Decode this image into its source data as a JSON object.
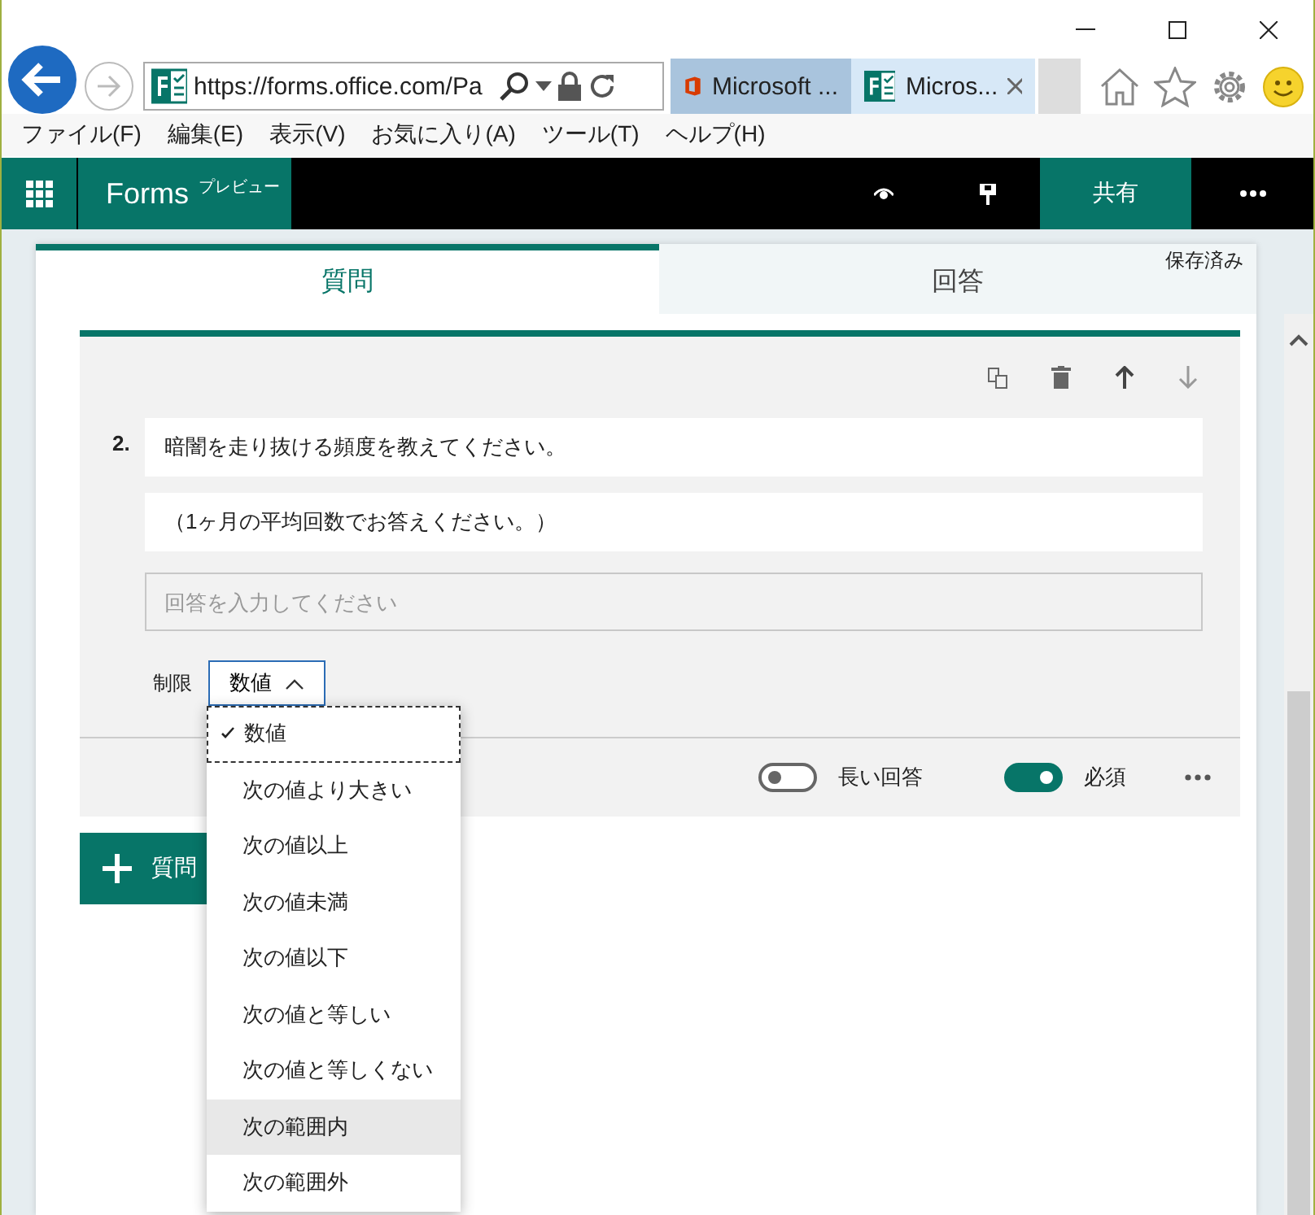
{
  "browser": {
    "address": "https://forms.office.com/Pa",
    "tabs": [
      {
        "title": "Microsoft ...",
        "kind": "office",
        "selected": false
      },
      {
        "title": "Micros...",
        "kind": "forms",
        "selected": true
      }
    ],
    "menu": [
      "ファイル(F)",
      "編集(E)",
      "表示(V)",
      "お気に入り(A)",
      "ツール(T)",
      "ヘルプ(H)"
    ]
  },
  "app": {
    "name": "Forms",
    "badge": "プレビュー",
    "share": "共有"
  },
  "form_tabs": [
    {
      "label": "質問",
      "selected": true
    },
    {
      "label": "回答",
      "selected": false
    }
  ],
  "save_status": "保存済み",
  "question": {
    "number": "2.",
    "title": "暗闇を走り抜ける頻度を教えてください。",
    "subtitle": "（1ヶ月の平均回数でお答えください。）",
    "answer_placeholder": "回答を入力してください",
    "restriction_label": "制限",
    "restriction_value": "数値",
    "expanded": true,
    "toggles": [
      {
        "label": "長い回答",
        "on": false
      },
      {
        "label": "必須",
        "on": true
      }
    ]
  },
  "add_button": {
    "label": "質問"
  },
  "dropdown": {
    "options": [
      {
        "label": "数値",
        "selected": true,
        "hovered": false
      },
      {
        "label": "次の値より大きい",
        "selected": false,
        "hovered": false
      },
      {
        "label": "次の値以上",
        "selected": false,
        "hovered": false
      },
      {
        "label": "次の値未満",
        "selected": false,
        "hovered": false
      },
      {
        "label": "次の値以下",
        "selected": false,
        "hovered": false
      },
      {
        "label": "次の値と等しい",
        "selected": false,
        "hovered": false
      },
      {
        "label": "次の値と等しくない",
        "selected": false,
        "hovered": false
      },
      {
        "label": "次の範囲内",
        "selected": false,
        "hovered": true
      },
      {
        "label": "次の範囲外",
        "selected": false,
        "hovered": false
      }
    ]
  }
}
